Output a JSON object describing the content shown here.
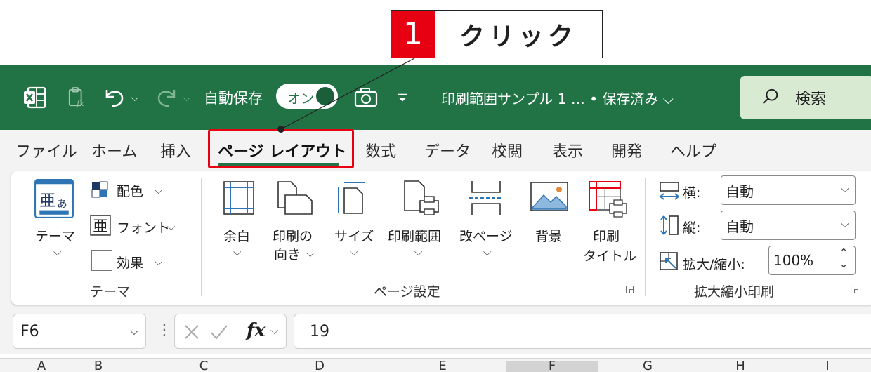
{
  "callout": {
    "number": "1",
    "text": "クリック"
  },
  "titlebar": {
    "autosave_label": "自動保存",
    "autosave_toggle": "オン",
    "document_title": "印刷範囲サンプル 1 … • 保存済み ⌵",
    "search_label": "検索"
  },
  "tabs": [
    "ファイル",
    "ホーム",
    "挿入",
    "ページ レイアウト",
    "数式",
    "データ",
    "校閲",
    "表示",
    "開発",
    "ヘルプ"
  ],
  "ribbon": {
    "theme_group": {
      "theme_button": "テーマ",
      "colors": "配色",
      "fonts": "フォント",
      "effects": "効果",
      "group_label": "テーマ"
    },
    "page_setup_group": {
      "margins": "余白",
      "orientation_line1": "印刷の",
      "orientation_line2": "向き",
      "size": "サイズ",
      "print_area": "印刷範囲",
      "breaks": "改ページ",
      "background": "背景",
      "print_titles_line1": "印刷",
      "print_titles_line2": "タイトル",
      "group_label": "ページ設定"
    },
    "scale_group": {
      "width_label": "横:",
      "width_value": "自動",
      "height_label": "縦:",
      "height_value": "自動",
      "scale_label": "拡大/縮小:",
      "scale_value": "100%",
      "group_label": "拡大縮小印刷"
    }
  },
  "formula_bar": {
    "name_box": "F6",
    "fx_label": "fx",
    "formula_value": "19"
  },
  "columns": [
    "A",
    "B",
    "C",
    "D",
    "E",
    "F",
    "G",
    "H",
    "I"
  ],
  "colors": {
    "title_bar": "#217346",
    "tab_underline": "#217346",
    "highlight": "#e60012",
    "callout_number_bg": "#e60012"
  }
}
